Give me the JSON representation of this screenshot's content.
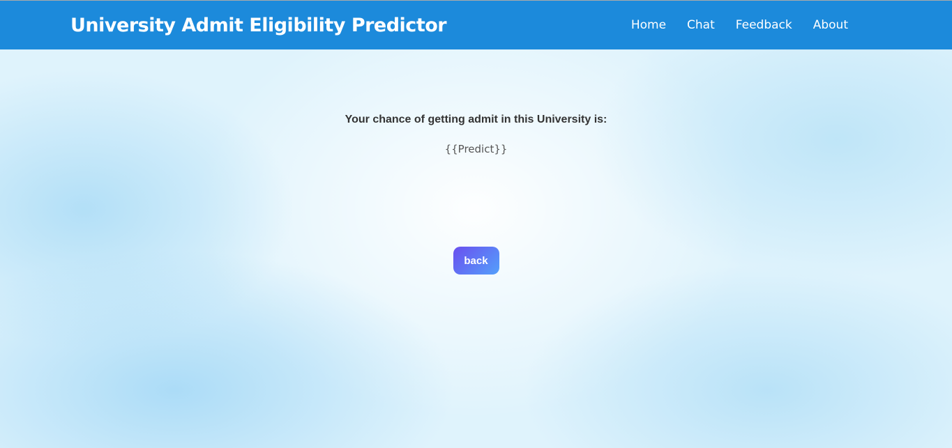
{
  "header": {
    "title": "University Admit Eligibility Predictor",
    "nav": [
      "Home",
      "Chat",
      "Feedback",
      "About"
    ]
  },
  "main": {
    "label": "Your chance of getting admit in this University is:",
    "result": "{{Predict}}",
    "back_label": "back"
  },
  "colors": {
    "header": "#1c8adb",
    "button_start": "#6a4fef",
    "button_end": "#54a0fb"
  }
}
